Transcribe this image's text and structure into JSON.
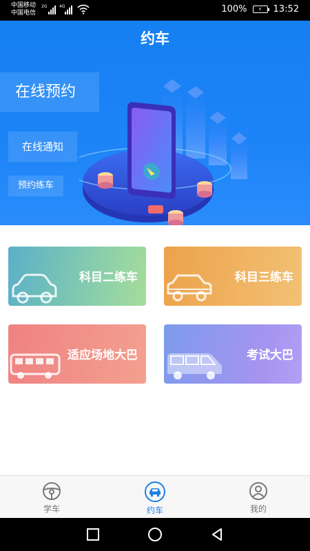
{
  "status": {
    "carrier1": "中国移动",
    "carrier2": "中国电信",
    "net1": "2G",
    "net2": "4G",
    "battery": "100%",
    "time": "13:52"
  },
  "header": {
    "title": "约车"
  },
  "banner": {
    "pill_large": "在线预约",
    "pill_medium": "在线通知",
    "pill_small": "预约练车"
  },
  "cards": [
    {
      "label": "科目二练车",
      "icon": "car-icon"
    },
    {
      "label": "科目三练车",
      "icon": "car-icon"
    },
    {
      "label": "适应场地大巴",
      "icon": "bus-icon"
    },
    {
      "label": "考试大巴",
      "icon": "van-icon"
    }
  ],
  "tabs": [
    {
      "label": "学车",
      "icon": "steering-wheel-icon",
      "active": false
    },
    {
      "label": "约车",
      "icon": "car-icon",
      "active": true
    },
    {
      "label": "我的",
      "icon": "profile-icon",
      "active": false
    }
  ],
  "colors": {
    "accent": "#1d7ee6",
    "banner": "#1a82f5"
  }
}
